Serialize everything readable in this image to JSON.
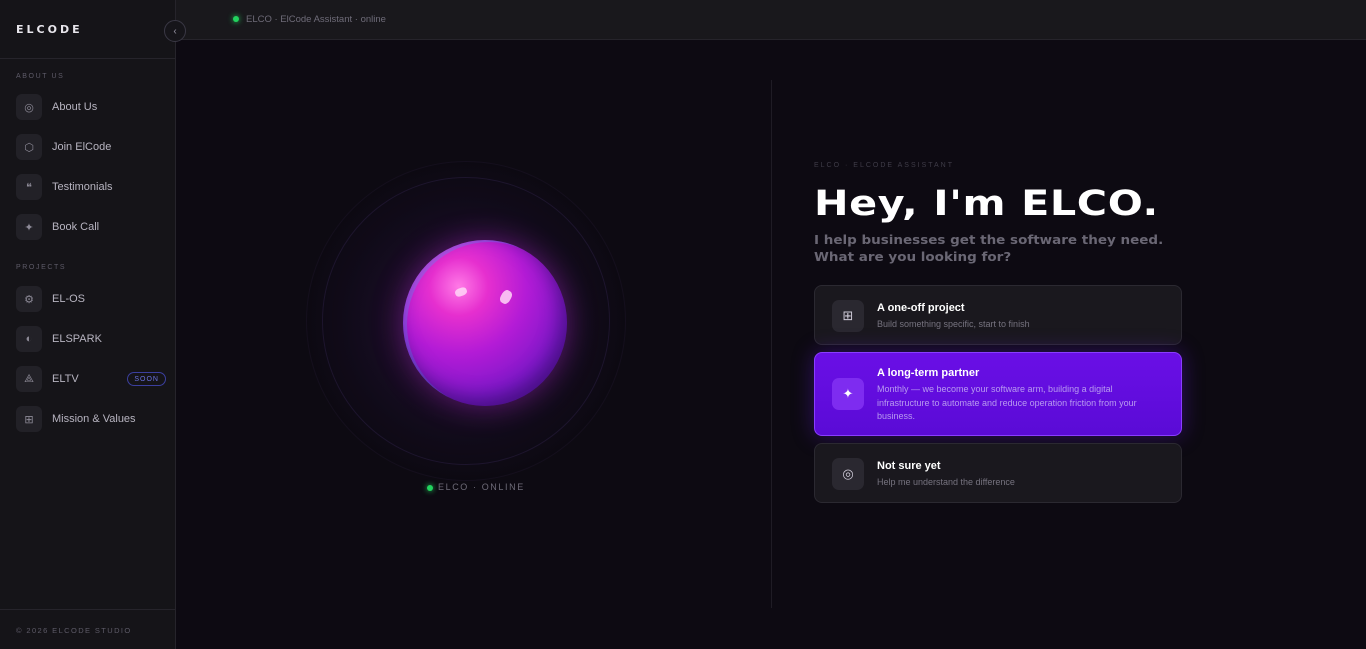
{
  "sidebar": {
    "logo": "ELCODE",
    "collapse_icon": "chevron-left-icon",
    "sections": [
      {
        "label": "ABOUT US",
        "items": [
          {
            "label": "About Us",
            "icon": "target-icon",
            "glyph": "◎"
          },
          {
            "label": "Join ElCode",
            "icon": "hexagon-icon",
            "glyph": "⬡"
          },
          {
            "label": "Testimonials",
            "icon": "quote-icon",
            "glyph": "❝"
          },
          {
            "label": "Book Call",
            "icon": "sparkle-icon",
            "glyph": "✦"
          }
        ]
      },
      {
        "label": "PROJECTS",
        "items": [
          {
            "label": "EL-OS",
            "icon": "gear-icon",
            "glyph": "⚙"
          },
          {
            "label": "ELSPARK",
            "icon": "half-circle-icon",
            "glyph": "◐"
          },
          {
            "label": "ELTV",
            "icon": "triangle-icon",
            "glyph": "⟁",
            "badge": "SOON"
          },
          {
            "label": "Mission & Values",
            "icon": "grid-icon",
            "glyph": "⊞"
          }
        ]
      }
    ],
    "footer": "© 2026 ELCODE STUDIO"
  },
  "topbar": {
    "status_text": "ELCO · ElCode Assistant · online",
    "status_color": "#22d35e"
  },
  "stage": {
    "orb_label": "ELCO · ONLINE"
  },
  "hero": {
    "eyebrow": "ELCO · ELCODE ASSISTANT",
    "headline": "Hey, I'm ELCO.",
    "subline_1": "I help businesses get the software they need.",
    "subline_2": "What are you looking for?"
  },
  "options": [
    {
      "title": "A one-off project",
      "desc": "Build something specific, start to finish",
      "icon": "grid-icon",
      "glyph": "⊞",
      "selected": false
    },
    {
      "title": "A long-term partner",
      "desc": "Monthly — we become your software arm, building a digital infrastructure to automate and reduce operation friction from your business.",
      "icon": "sparkle-icon",
      "glyph": "✦",
      "selected": true
    },
    {
      "title": "Not sure yet",
      "desc": "Help me understand the difference",
      "icon": "target-icon",
      "glyph": "◎",
      "selected": false
    }
  ],
  "colors": {
    "accent": "#6a0fe6",
    "background": "#0d0a12",
    "sidebar": "#151418",
    "online": "#22d35e"
  }
}
